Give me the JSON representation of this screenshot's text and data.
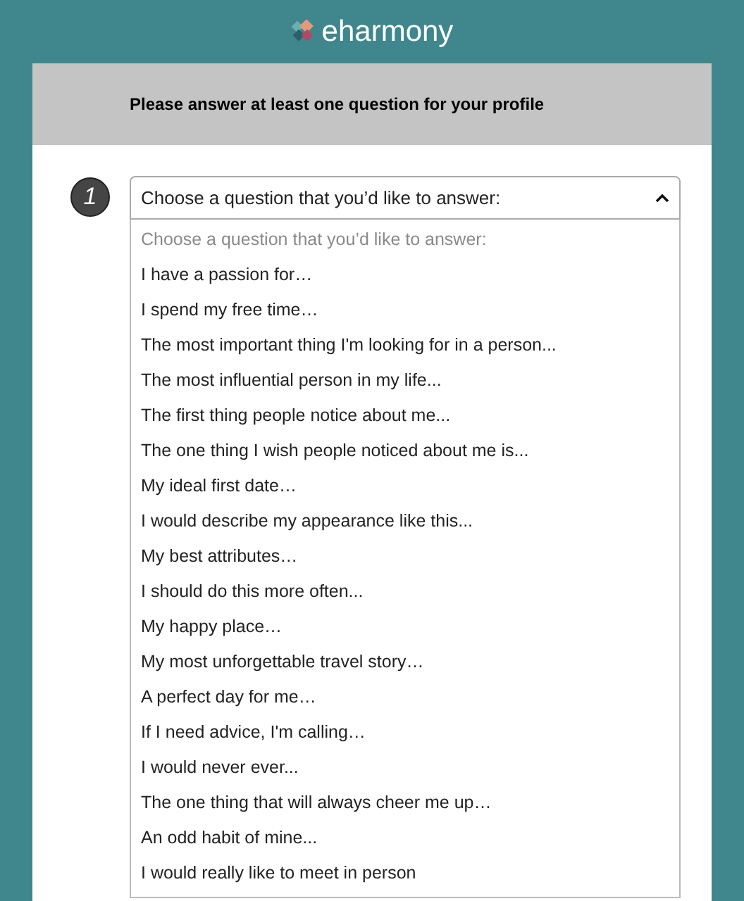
{
  "brand": {
    "name": "eharmony"
  },
  "card": {
    "heading": "Please answer at least one question for your profile"
  },
  "question": {
    "number": "1",
    "select": {
      "value": "Choose a question that you’d like to answer:",
      "expanded": true
    },
    "options": [
      {
        "label": "Choose a question that you’d like to answer:",
        "kind": "placeholder"
      },
      {
        "label": "I have a passion for…",
        "kind": "option"
      },
      {
        "label": "I spend my free time…",
        "kind": "option"
      },
      {
        "label": "The most important thing I'm looking for in a person...",
        "kind": "option"
      },
      {
        "label": "The most influential person in my life...",
        "kind": "option"
      },
      {
        "label": "The first thing people notice about me...",
        "kind": "option"
      },
      {
        "label": "The one thing I wish people noticed about me is...",
        "kind": "option"
      },
      {
        "label": "My ideal first date…",
        "kind": "option"
      },
      {
        "label": "I would describe my appearance like this...",
        "kind": "option"
      },
      {
        "label": "My best attributes…",
        "kind": "option"
      },
      {
        "label": "I should do this more often...",
        "kind": "option"
      },
      {
        "label": "My happy place…",
        "kind": "option"
      },
      {
        "label": "My most unforgettable travel story…",
        "kind": "option"
      },
      {
        "label": "A perfect day for me…",
        "kind": "option"
      },
      {
        "label": "If I need advice, I'm calling…",
        "kind": "option"
      },
      {
        "label": "I would never ever...",
        "kind": "option"
      },
      {
        "label": "The one thing that will always cheer me up…",
        "kind": "option"
      },
      {
        "label": "An odd habit of mine...",
        "kind": "option"
      },
      {
        "label": "I would really like to meet in person",
        "kind": "option"
      }
    ]
  }
}
